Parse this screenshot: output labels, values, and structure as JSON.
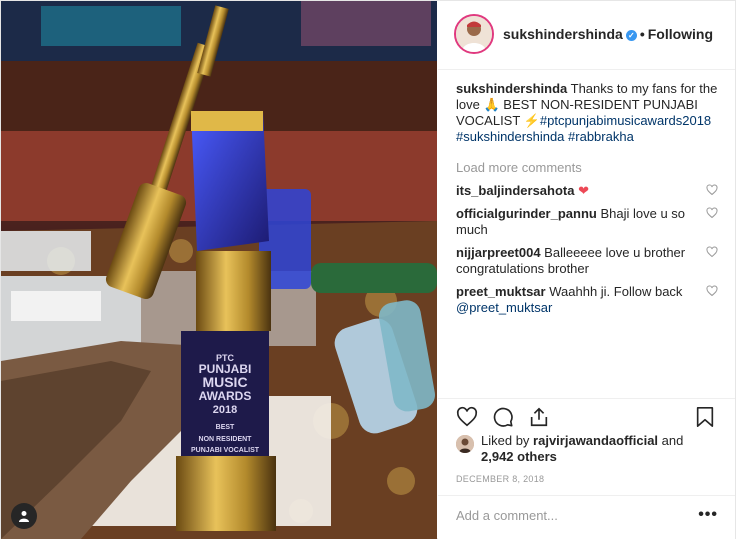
{
  "post": {
    "username": "sukshindershinda",
    "follow_status": "Following",
    "separator": "•",
    "caption": {
      "username": "sukshindershinda",
      "text_1": "Thanks to my fans for the love",
      "emoji_pray": "🙏",
      "text_2": "BEST NON-RESIDENT PUNJABI VOCALIST",
      "emoji_bolt": "⚡",
      "hashtag_1": "#ptcpunjabimusicawards2018",
      "hashtag_2": "#sukshindershinda",
      "hashtag_3": "#rabbrakha"
    },
    "load_more": "Load more comments",
    "comments": [
      {
        "user": "its_baljindersahota",
        "text": "",
        "emoji": "❤"
      },
      {
        "user": "officialgurinder_pannu",
        "text": "Bhaji love u so much"
      },
      {
        "user": "nijjarpreet004",
        "text": "Balleeeee love u brother congratulations brother"
      },
      {
        "user": "preet_muktsar",
        "text": "Waahhh ji. Follow back",
        "mention": "@preet_muktsar"
      }
    ],
    "likes": {
      "prefix": "Liked by",
      "user": "rajvirjawandaofficial",
      "middle": "and",
      "count": "2,942 others"
    },
    "date": "DECEMBER 8, 2018",
    "add_comment_placeholder": "Add a comment...",
    "more_options": "•••"
  },
  "photo": {
    "trophy_line_1": "PTC",
    "trophy_line_2": "PUNJABI",
    "trophy_line_3": "MUSIC",
    "trophy_line_4": "AWARDS",
    "trophy_line_5": "2018",
    "trophy_line_6": "BEST",
    "trophy_line_7": "NON RESIDENT",
    "trophy_line_8": "PUNJABI VOCALIST"
  },
  "colors": {
    "link": "#003569",
    "verified": "#3897f0",
    "muted": "#999999",
    "heart_red": "#ed4956"
  },
  "icons": [
    "like-icon",
    "comment-icon",
    "share-icon",
    "save-icon",
    "verified-icon",
    "heart-small-icon",
    "user-icon"
  ]
}
